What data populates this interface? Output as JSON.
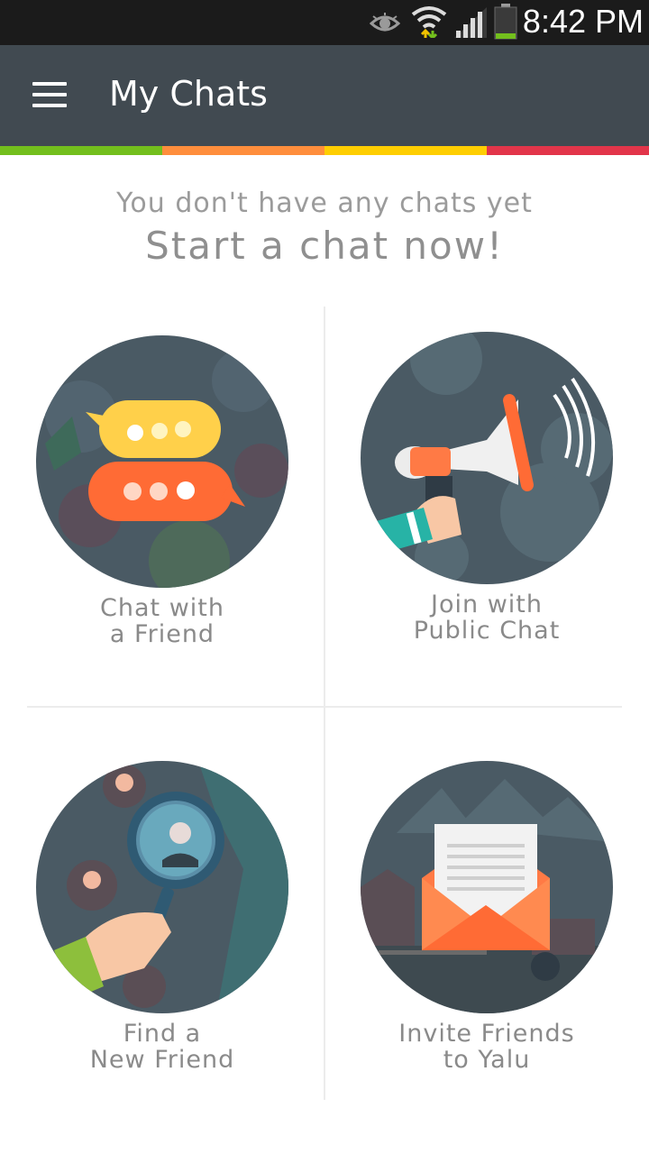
{
  "status_bar": {
    "time": "8:42 PM",
    "icons": [
      "eye-icon",
      "wifi-icon",
      "signal-icon",
      "battery-icon"
    ]
  },
  "app_bar": {
    "title": "My Chats",
    "menu_icon": "hamburger-menu-icon"
  },
  "color_strip": [
    "#73bf1d",
    "#ff8e3c",
    "#fece02",
    "#e2354a"
  ],
  "empty_state": {
    "line1": "You don't have any chats yet",
    "line2": "Start a chat now!"
  },
  "tiles": [
    {
      "line1": "Chat with",
      "line2": "a Friend",
      "icon": "chat-bubbles-icon"
    },
    {
      "line1": "Join with",
      "line2": "Public Chat",
      "icon": "megaphone-icon"
    },
    {
      "line1": "Find a",
      "line2": "New Friend",
      "icon": "magnifier-icon"
    },
    {
      "line1": "Invite Friends",
      "line2": "to Yalu",
      "icon": "envelope-icon"
    }
  ],
  "colors": {
    "app_bar": "#414a51",
    "circle_bg": "#4a5a64",
    "accent_orange": "#ff6b35",
    "accent_yellow": "#ffd04a"
  }
}
